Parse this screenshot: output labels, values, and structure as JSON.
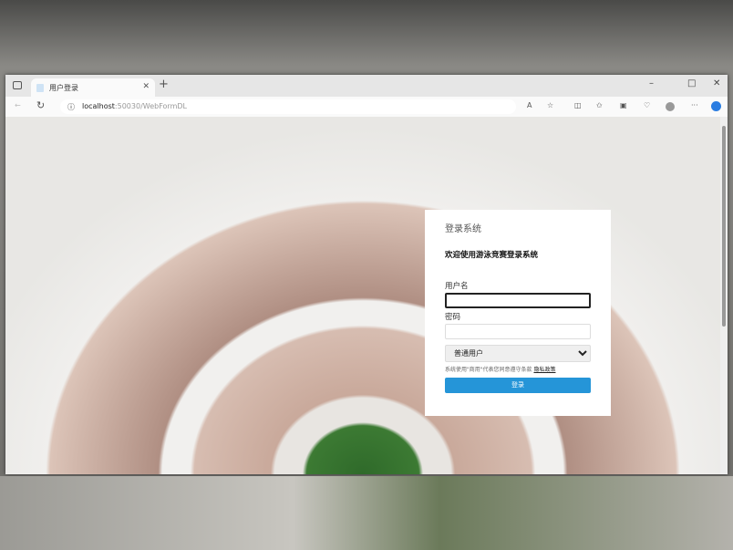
{
  "browser": {
    "tab_title": "用户登录",
    "url_host": "localhost",
    "url_rest": ":50030/WebFormDL",
    "window_controls": [
      "–",
      "□",
      "✕"
    ],
    "toolbar_icons": [
      "read-aloud-icon",
      "favorite-star-icon",
      "split-screen-icon",
      "favorites-icon",
      "collections-icon",
      "browser-essentials-icon",
      "profile-icon",
      "more-icon",
      "copilot-icon"
    ]
  },
  "login": {
    "title": "登录系统",
    "welcome": "欢迎使用游泳竞赛登录系统",
    "username_label": "用户名",
    "username_value": "",
    "password_label": "密码",
    "password_value": "",
    "role_selected": "普通用户",
    "hint": "系统使用\"商用\"代表您同意遵守条款",
    "privacy_link": "隐私政策",
    "submit_label": "登录"
  }
}
